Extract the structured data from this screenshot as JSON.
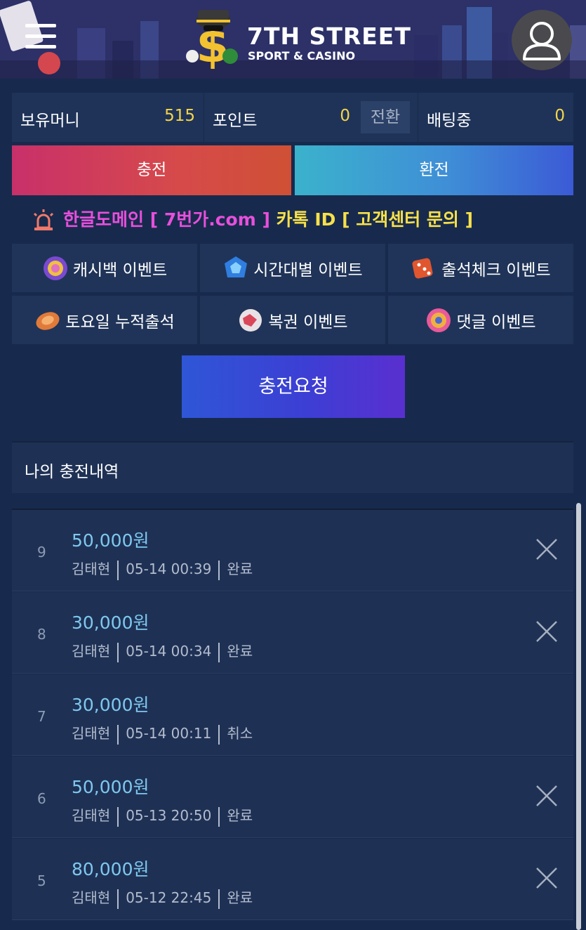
{
  "header": {
    "brand_title": "7TH STREET",
    "brand_subtitle": "SPORT & CASINO",
    "menu_icon": "hamburger-icon",
    "profile_icon": "user-icon"
  },
  "balance": {
    "money_label": "보유머니",
    "money_value": "515",
    "point_label": "포인트",
    "point_value": "0",
    "convert_label": "전환",
    "betting_label": "배팅중",
    "betting_value": "0"
  },
  "actions": {
    "deposit_label": "충전",
    "withdraw_label": "환전"
  },
  "notice": {
    "icon": "alarm-icon",
    "part1": "한글도메인 [ 7번가.com ]",
    "part2": "카톡 ID [ 고객센터 문의 ]"
  },
  "events": [
    {
      "label": "캐시백 이벤트",
      "icon": "cashback-coin-icon"
    },
    {
      "label": "시간대별 이벤트",
      "icon": "gem-icon"
    },
    {
      "label": "출석체크 이벤트",
      "icon": "dice-icon"
    },
    {
      "label": "토요일 누적출석",
      "icon": "chip-icon"
    },
    {
      "label": "복권 이벤트",
      "icon": "lottery-ball-icon"
    },
    {
      "label": "댓글 이벤트",
      "icon": "donut-coin-icon"
    }
  ],
  "request_button": "충전요청",
  "history": {
    "title": "나의 충전내역",
    "rows": [
      {
        "no": "9",
        "amount": "50,000원",
        "name": "김태현",
        "datetime": "05-14 00:39",
        "status": "완료",
        "closable": true
      },
      {
        "no": "8",
        "amount": "30,000원",
        "name": "김태현",
        "datetime": "05-14 00:34",
        "status": "완료",
        "closable": true
      },
      {
        "no": "7",
        "amount": "30,000원",
        "name": "김태현",
        "datetime": "05-14 00:11",
        "status": "취소",
        "closable": false
      },
      {
        "no": "6",
        "amount": "50,000원",
        "name": "김태현",
        "datetime": "05-13 20:50",
        "status": "완료",
        "closable": true
      },
      {
        "no": "5",
        "amount": "80,000원",
        "name": "김태현",
        "datetime": "05-12 22:45",
        "status": "완료",
        "closable": true
      }
    ]
  },
  "colors": {
    "background": "#172a4d",
    "panel": "#1e3155",
    "balance_value": "#f5d54a",
    "amount": "#7fc8ee",
    "notice_pink": "#e84fdc",
    "notice_yellow": "#f7e04a"
  }
}
